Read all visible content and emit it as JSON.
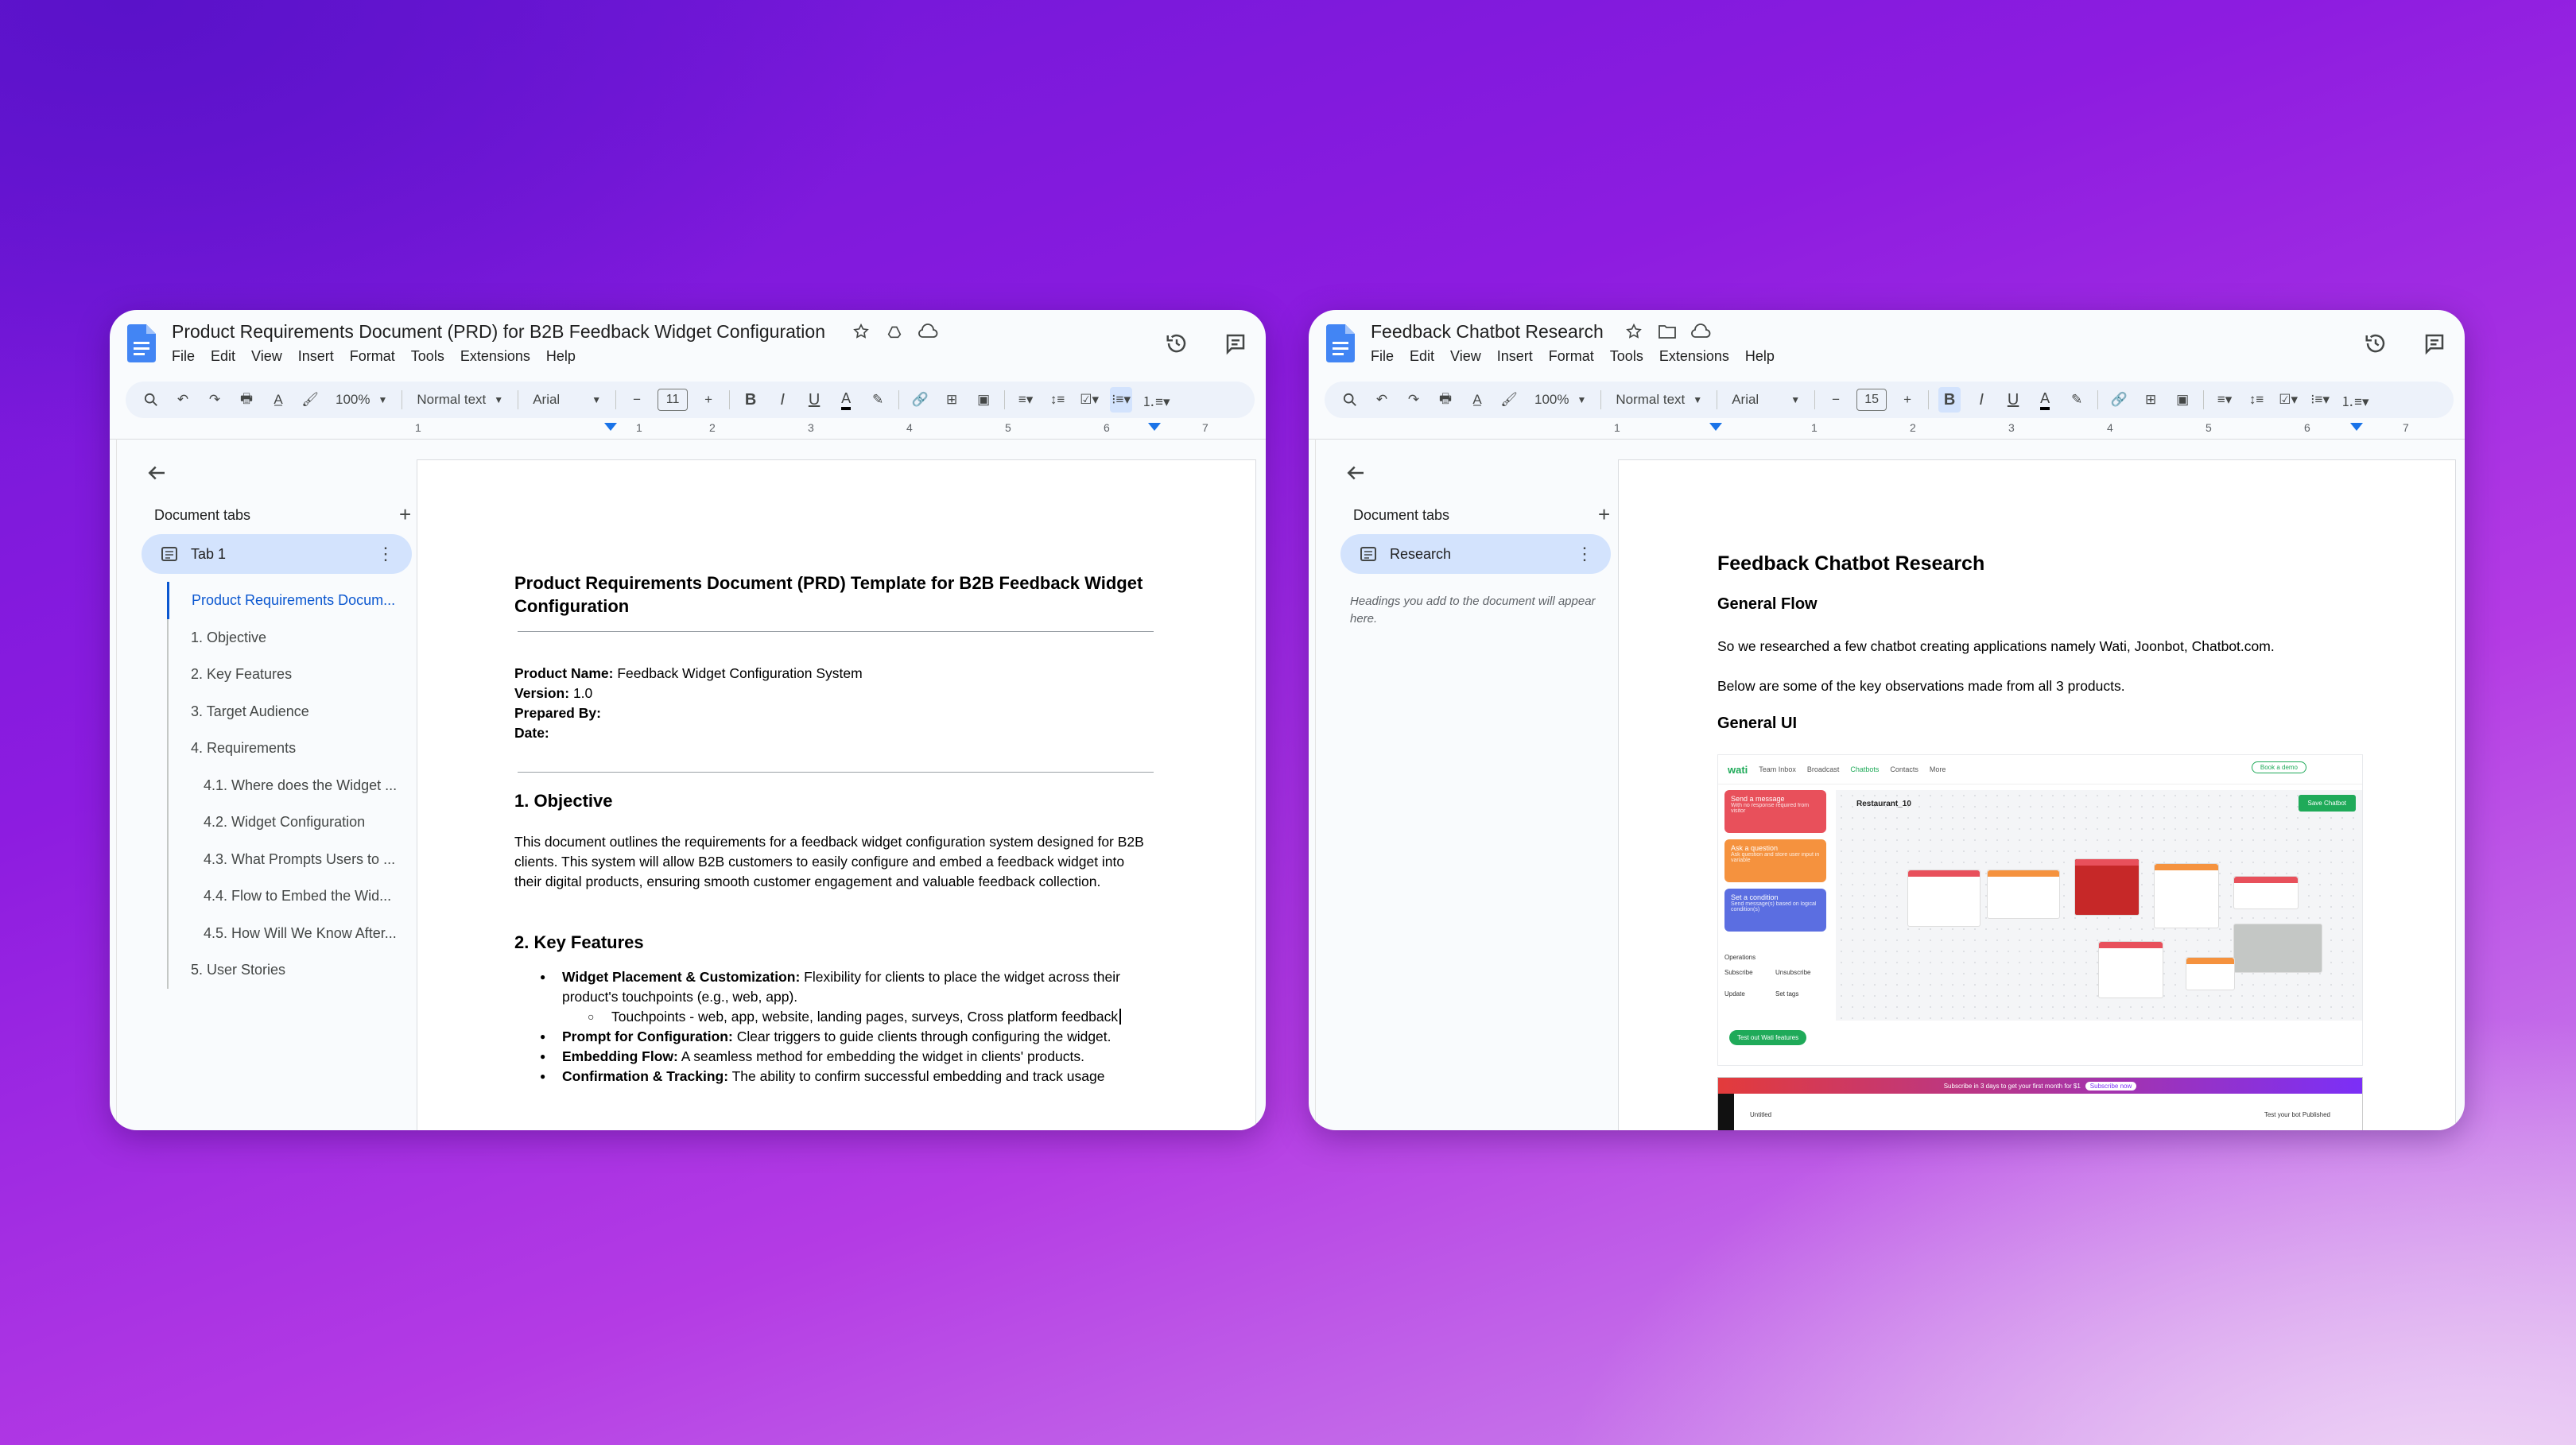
{
  "left_doc": {
    "title": "Product Requirements Document (PRD) for B2B Feedback Widget Configuration",
    "menu": [
      "File",
      "Edit",
      "View",
      "Insert",
      "Format",
      "Tools",
      "Extensions",
      "Help"
    ],
    "toolbar": {
      "zoom": "100%",
      "style": "Normal text",
      "font": "Arial",
      "font_size": "11"
    },
    "ruler": [
      "1",
      "1",
      "2",
      "3",
      "4",
      "5",
      "6",
      "7"
    ],
    "sidebar": {
      "header": "Document tabs",
      "tab": "Tab 1",
      "outline": [
        {
          "label": "Product Requirements Docum...",
          "level": 1,
          "active": true
        },
        {
          "label": "1. Objective",
          "level": 2
        },
        {
          "label": "2. Key Features",
          "level": 2
        },
        {
          "label": "3. Target Audience",
          "level": 2
        },
        {
          "label": "4. Requirements",
          "level": 2
        },
        {
          "label": "4.1. Where does the Widget ...",
          "level": 3
        },
        {
          "label": "4.2. Widget Configuration",
          "level": 3
        },
        {
          "label": "4.3. What Prompts Users to ...",
          "level": 3
        },
        {
          "label": "4.4. Flow to Embed the Wid...",
          "level": 3
        },
        {
          "label": "4.5. How Will We Know After...",
          "level": 3
        },
        {
          "label": "5. User Stories",
          "level": 2
        }
      ]
    },
    "body": {
      "heading": "Product Requirements Document (PRD) Template for B2B Feedback Widget Configuration",
      "product_name_label": "Product Name:",
      "product_name": "Feedback Widget Configuration System",
      "version_label": "Version:",
      "version": "1.0",
      "prepared_by_label": "Prepared By:",
      "date_label": "Date:",
      "objective_heading": "1. Objective",
      "objective_text": "This document outlines the requirements for a feedback widget configuration system designed for B2B clients. This system will allow B2B customers to easily configure and embed a feedback widget into their digital products, ensuring smooth customer engagement and valuable feedback collection.",
      "features_heading": "2. Key Features",
      "features": [
        {
          "bold": "Widget Placement & Customization:",
          "text": " Flexibility for clients to place the widget across their product's touchpoints (e.g., web, app)."
        },
        {
          "sub": "Touchpoints - web, app, website, landing pages, surveys, Cross platform feedback"
        },
        {
          "bold": "Prompt for Configuration:",
          "text": " Clear triggers to guide clients through configuring the widget."
        },
        {
          "bold": "Embedding Flow:",
          "text": " A seamless method for embedding the widget in clients' products."
        },
        {
          "bold": "Confirmation & Tracking:",
          "text": " The ability to confirm successful embedding and track usage"
        }
      ]
    }
  },
  "right_doc": {
    "title": "Feedback Chatbot Research",
    "menu": [
      "File",
      "Edit",
      "View",
      "Insert",
      "Format",
      "Tools",
      "Extensions",
      "Help"
    ],
    "toolbar": {
      "zoom": "100%",
      "style": "Normal text",
      "font": "Arial",
      "font_size": "15"
    },
    "ruler": [
      "1",
      "1",
      "2",
      "3",
      "4",
      "5",
      "6",
      "7"
    ],
    "sidebar": {
      "header": "Document tabs",
      "tab": "Research",
      "hint": "Headings you add to the document will appear here."
    },
    "body": {
      "title": "Feedback Chatbot Research",
      "h_general_flow": "General Flow",
      "p1": "So we researched a few chatbot creating applications namely Wati, Joonbot, Chatbot.com.",
      "p2": "Below are some of the key observations made from all 3 products.",
      "h_general_ui": "General UI"
    },
    "screenshot": {
      "logo": "wati",
      "nav": [
        "Team Inbox",
        "Broadcast",
        "Chatbots",
        "Contacts",
        "More"
      ],
      "book_demo": "Book a demo",
      "canvas_title": "Restaurant_10",
      "save": "Save Chatbot",
      "cards": [
        {
          "label": "Send a message",
          "sub": "With no response required from visitor",
          "color": "#e8505b"
        },
        {
          "label": "Ask a question",
          "sub": "Ask question and store user input in variable",
          "color": "#f5923e"
        },
        {
          "label": "Set a condition",
          "sub": "Send message(s) based on logical condition(s)",
          "color": "#5b6ee1"
        }
      ],
      "operations": "Operations",
      "ops": [
        "Subscribe",
        "Unsubscribe",
        "Update",
        "Set tags"
      ],
      "try_out": "Test out Wati features",
      "banner": "Subscribe in 3 days to get your first month for $1",
      "subscribe": "Subscribe now",
      "bar_title": "Untitled",
      "bar_right": "Test your bot   Published"
    }
  }
}
